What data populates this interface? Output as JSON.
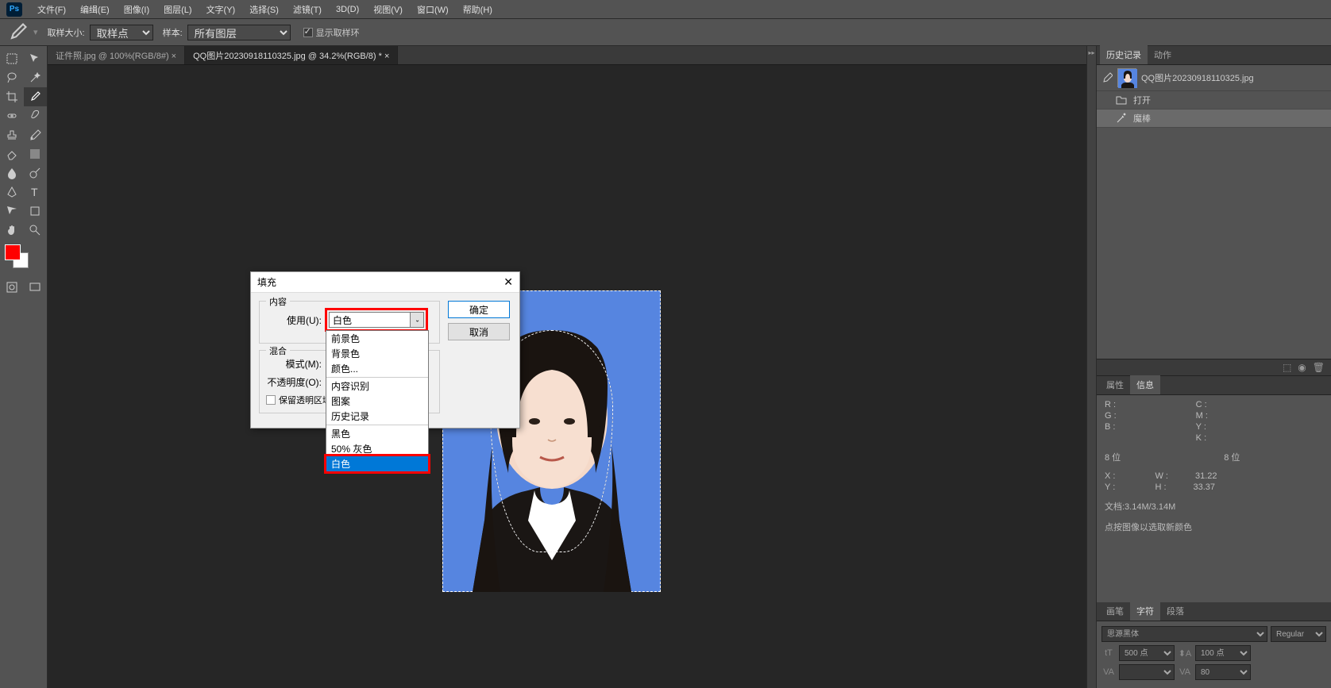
{
  "menubar": {
    "items": [
      "文件(F)",
      "编缉(E)",
      "图像(I)",
      "图层(L)",
      "文字(Y)",
      "选择(S)",
      "滤镜(T)",
      "3D(D)",
      "视图(V)",
      "窗口(W)",
      "帮助(H)"
    ]
  },
  "optionsbar": {
    "sample_size_label": "取样大小:",
    "sample_size_value": "取样点",
    "sample_label": "样本:",
    "sample_value": "所有图层",
    "show_ring": "显示取样环"
  },
  "tabs": [
    {
      "label": "证件照.jpg @ 100%(RGB/8#) ×",
      "active": false
    },
    {
      "label": "QQ图片20230918110325.jpg @ 34.2%(RGB/8) * ×",
      "active": true
    }
  ],
  "dialog": {
    "title": "填充",
    "ok": "确定",
    "cancel": "取消",
    "content_label": "内容",
    "use_label": "使用(U):",
    "use_value": "白色",
    "blend_label": "混合",
    "mode_label": "模式(M):",
    "opacity_label": "不透明度(O):",
    "preserve_trans": "保留透明区域"
  },
  "dropdown": {
    "items": [
      "前景色",
      "背景色",
      "颜色...",
      "",
      "内容识别",
      "图案",
      "历史记录",
      "",
      "黑色",
      "50% 灰色",
      "白色"
    ],
    "selected": "白色"
  },
  "history": {
    "tab_history": "历史记录",
    "tab_actions": "动作",
    "doc_name": "QQ图片20230918110325.jpg",
    "items": [
      {
        "icon": "folder",
        "label": "打开"
      },
      {
        "icon": "wand",
        "label": "魔棒",
        "active": true
      }
    ]
  },
  "properties": {
    "tab_props": "属性",
    "tab_info": "信息"
  },
  "info": {
    "r": "R :",
    "g": "G :",
    "b": "B :",
    "c": "C :",
    "m": "M :",
    "y_cmyk": "Y :",
    "k": "K :",
    "bit1": "8 位",
    "bit2": "8 位",
    "x": "X :",
    "y": "Y :",
    "w": "W :",
    "h": "H :",
    "w_val": "31.22",
    "h_val": "33.37",
    "doc": "文档:3.14M/3.14M",
    "hint": "点按图像以选取新颜色"
  },
  "char": {
    "tab_brush": "画笔",
    "tab_char": "字符",
    "tab_para": "段落",
    "font": "思源黑体",
    "style": "Regular",
    "size": "500 点",
    "leading": "100 点",
    "va": "VA",
    "tracking": "80"
  }
}
